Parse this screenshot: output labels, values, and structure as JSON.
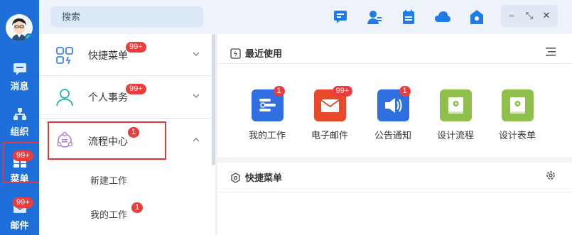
{
  "rail": {
    "items": [
      {
        "label": "消息",
        "icon": "message-icon"
      },
      {
        "label": "组织",
        "icon": "org-icon"
      },
      {
        "label": "菜单",
        "icon": "grid-menu-icon",
        "badge": "99+"
      },
      {
        "label": "邮件",
        "icon": "mail-icon",
        "badge": "99+"
      }
    ]
  },
  "search": {
    "placeholder": "搜索"
  },
  "window": {
    "minimize": "–",
    "maximize": "⤡",
    "close": "✕"
  },
  "menu": {
    "items": [
      {
        "label": "快捷菜单",
        "badge": "99+",
        "icon": "apps-icon"
      },
      {
        "label": "个人事务",
        "badge": "99+",
        "icon": "user-icon"
      },
      {
        "label": "流程中心",
        "badge": "1",
        "icon": "workflow-icon"
      }
    ],
    "sub_items": [
      {
        "label": "新建工作"
      },
      {
        "label": "我的工作",
        "badge": "1"
      }
    ]
  },
  "recent": {
    "title": "最近使用",
    "apps": [
      {
        "label": "我的工作",
        "badge": "1",
        "color": "#2f6fe0"
      },
      {
        "label": "电子邮件",
        "badge": "99+",
        "color": "#e8492b"
      },
      {
        "label": "公告通知",
        "badge": "1",
        "color": "#2f6fe0"
      },
      {
        "label": "设计流程",
        "color": "#8fbf4c"
      },
      {
        "label": "设计表单",
        "color": "#8fbf4c"
      }
    ]
  },
  "shortcuts": {
    "title": "快捷菜单"
  },
  "colors": {
    "rail": "#1e6fd9",
    "badge": "#ef3b3b",
    "highlight": "#e23a3a"
  }
}
